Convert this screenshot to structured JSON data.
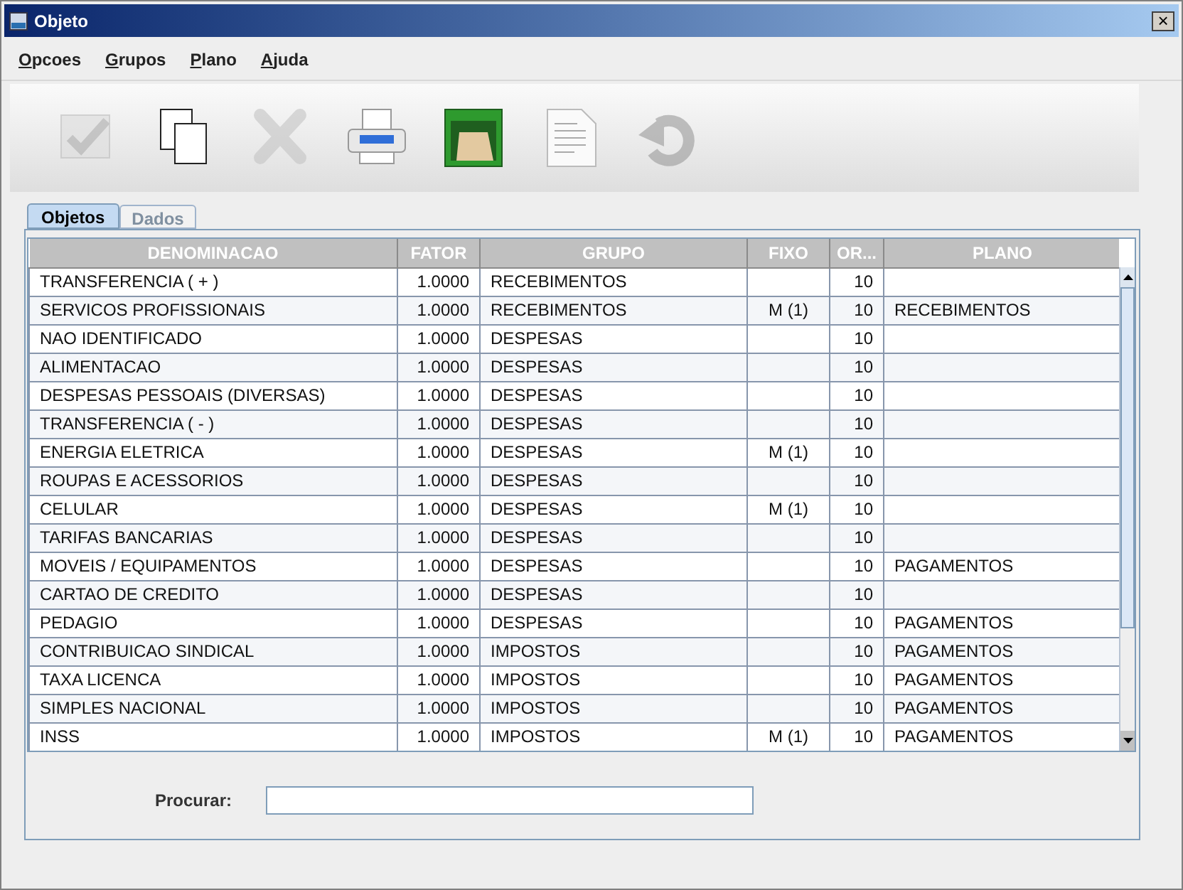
{
  "window": {
    "title": "Objeto",
    "close": "×"
  },
  "menu": [
    {
      "label": "Opcoes"
    },
    {
      "label": "Grupos"
    },
    {
      "label": "Plano"
    },
    {
      "label": "Ajuda"
    }
  ],
  "toolbar": [
    {
      "kind": "confirm",
      "disabled": true
    },
    {
      "kind": "copy",
      "disabled": false
    },
    {
      "kind": "delete",
      "disabled": true
    },
    {
      "kind": "print",
      "disabled": false
    },
    {
      "kind": "archive",
      "disabled": false
    },
    {
      "kind": "document",
      "disabled": false
    },
    {
      "kind": "undo",
      "disabled": true
    }
  ],
  "tabs": [
    {
      "label": "Objetos",
      "selected": true
    },
    {
      "label": "Dados",
      "selected": false
    }
  ],
  "table": {
    "columns": [
      "DENOMINACAO",
      "FATOR",
      "GRUPO",
      "FIXO",
      "OR...",
      "PLANO"
    ],
    "rows": [
      {
        "denominacao": "TRANSFERENCIA ( + )",
        "fator": "1.0000",
        "grupo": "RECEBIMENTOS",
        "column_5": "10"
      },
      {
        "denominacao": "SERVICOS PROFISSIONAIS",
        "fator": "1.0000",
        "grupo": "RECEBIMENTOS",
        "fixo": "M (1)",
        "column_5": "10",
        "plano": "RECEBIMENTOS"
      },
      {
        "denominacao": "NAO IDENTIFICADO",
        "fator": "1.0000",
        "grupo": "DESPESAS",
        "column_5": "10"
      },
      {
        "denominacao": "ALIMENTACAO",
        "fator": "1.0000",
        "grupo": "DESPESAS",
        "column_5": "10"
      },
      {
        "denominacao": "DESPESAS PESSOAIS (DIVERSAS)",
        "fator": "1.0000",
        "grupo": "DESPESAS",
        "column_5": "10"
      },
      {
        "denominacao": "TRANSFERENCIA ( - )",
        "fator": "1.0000",
        "grupo": "DESPESAS",
        "column_5": "10"
      },
      {
        "denominacao": "ENERGIA ELETRICA",
        "fator": "1.0000",
        "grupo": "DESPESAS",
        "fixo": "M (1)",
        "column_5": "10"
      },
      {
        "denominacao": "ROUPAS E ACESSORIOS",
        "fator": "1.0000",
        "grupo": "DESPESAS",
        "column_5": "10"
      },
      {
        "denominacao": "CELULAR",
        "fator": "1.0000",
        "grupo": "DESPESAS",
        "fixo": "M (1)",
        "column_5": "10"
      },
      {
        "denominacao": "TARIFAS BANCARIAS",
        "fator": "1.0000",
        "grupo": "DESPESAS",
        "column_5": "10"
      },
      {
        "denominacao": "MOVEIS / EQUIPAMENTOS",
        "fator": "1.0000",
        "grupo": "DESPESAS",
        "column_5": "10",
        "plano": "PAGAMENTOS"
      },
      {
        "denominacao": "CARTAO DE CREDITO",
        "fator": "1.0000",
        "grupo": "DESPESAS",
        "column_5": "10"
      },
      {
        "denominacao": "PEDAGIO",
        "fator": "1.0000",
        "grupo": "DESPESAS",
        "column_5": "10",
        "plano": "PAGAMENTOS"
      },
      {
        "denominacao": "CONTRIBUICAO SINDICAL",
        "fator": "1.0000",
        "grupo": "IMPOSTOS",
        "column_5": "10",
        "plano": "PAGAMENTOS"
      },
      {
        "denominacao": "TAXA LICENCA",
        "fator": "1.0000",
        "grupo": "IMPOSTOS",
        "column_5": "10",
        "plano": "PAGAMENTOS"
      },
      {
        "denominacao": "SIMPLES NACIONAL",
        "fator": "1.0000",
        "grupo": "IMPOSTOS",
        "column_5": "10",
        "plano": "PAGAMENTOS"
      },
      {
        "denominacao": "INSS",
        "fator": "1.0000",
        "grupo": "IMPOSTOS",
        "fixo": "M (1)",
        "column_5": "10",
        "plano": "PAGAMENTOS"
      }
    ]
  },
  "search": {
    "label": "Procurar:"
  }
}
